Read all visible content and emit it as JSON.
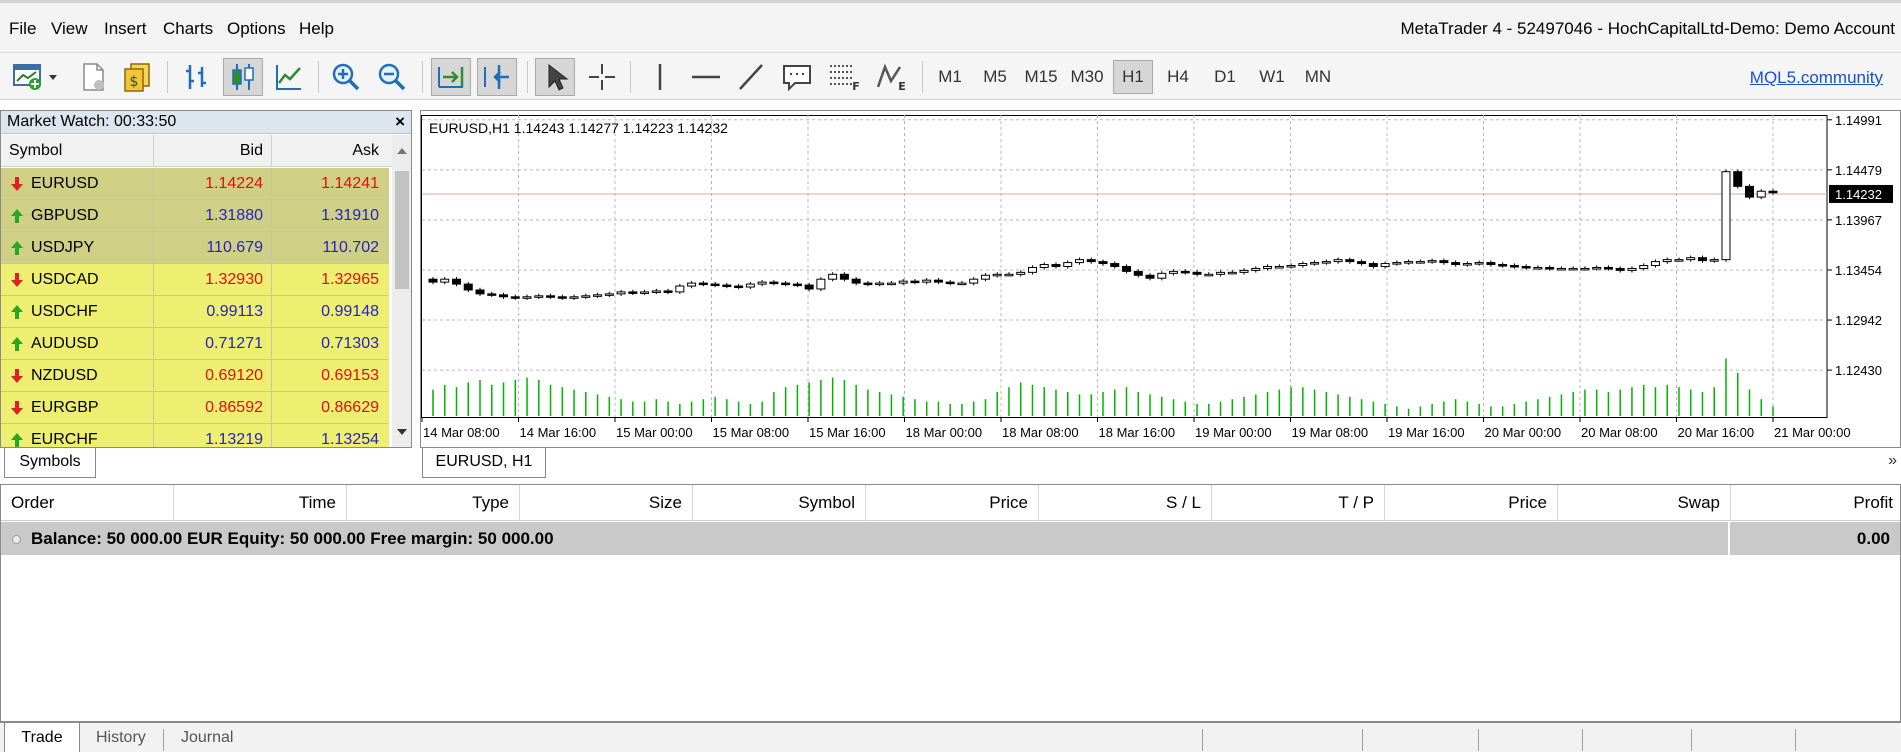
{
  "menu": [
    "File",
    "View",
    "Insert",
    "Charts",
    "Options",
    "Help"
  ],
  "window_title": "MetaTrader 4 - 52497046 - HochCapitalLtd-Demo: Demo Account",
  "toolbar": {
    "timeframes": [
      "M1",
      "M5",
      "M15",
      "M30",
      "H1",
      "H4",
      "D1",
      "W1",
      "MN"
    ],
    "active_timeframe": "H1",
    "community_link": "MQL5.community"
  },
  "market_watch": {
    "title": "Market Watch: 00:33:50",
    "columns": [
      "Symbol",
      "Bid",
      "Ask"
    ],
    "rows": [
      {
        "symbol": "EURUSD",
        "bid": "1.14224",
        "ask": "1.14241",
        "dir": "down",
        "selected": true
      },
      {
        "symbol": "GBPUSD",
        "bid": "1.31880",
        "ask": "1.31910",
        "dir": "up",
        "selected": true
      },
      {
        "symbol": "USDJPY",
        "bid": "110.679",
        "ask": "110.702",
        "dir": "up",
        "selected": true
      },
      {
        "symbol": "USDCAD",
        "bid": "1.32930",
        "ask": "1.32965",
        "dir": "down",
        "selected": false
      },
      {
        "symbol": "USDCHF",
        "bid": "0.99113",
        "ask": "0.99148",
        "dir": "up",
        "selected": false
      },
      {
        "symbol": "AUDUSD",
        "bid": "0.71271",
        "ask": "0.71303",
        "dir": "up",
        "selected": false
      },
      {
        "symbol": "NZDUSD",
        "bid": "0.69120",
        "ask": "0.69153",
        "dir": "down",
        "selected": false
      },
      {
        "symbol": "EURGBP",
        "bid": "0.86592",
        "ask": "0.86629",
        "dir": "down",
        "selected": false
      },
      {
        "symbol": "EURCHF",
        "bid": "1.13219",
        "ask": "1.13254",
        "dir": "up",
        "selected": false
      }
    ],
    "tab": "Symbols"
  },
  "chart_tab": "EURUSD, H1",
  "chart_data": {
    "type": "candlestick",
    "title": "EURUSD,H1  1.14243 1.14277 1.14223 1.14232",
    "current_price": 1.14232,
    "current_price_label": "1.14232",
    "ylim": [
      1.1195,
      1.1504
    ],
    "y_ticks": [
      1.14991,
      1.14479,
      1.13967,
      1.13454,
      1.12942,
      1.1243
    ],
    "y_tick_labels": [
      "1.14991",
      "1.14479",
      "1.13967",
      "1.13454",
      "1.12942",
      "1.12430"
    ],
    "x_tick_labels": [
      "14 Mar 08:00",
      "14 Mar 16:00",
      "15 Mar 00:00",
      "15 Mar 08:00",
      "15 Mar 16:00",
      "18 Mar 00:00",
      "18 Mar 08:00",
      "18 Mar 16:00",
      "19 Mar 00:00",
      "19 Mar 08:00",
      "19 Mar 16:00",
      "20 Mar 00:00",
      "20 Mar 08:00",
      "20 Mar 16:00",
      "21 Mar 00:00"
    ],
    "grid": true,
    "up_color": "#000000",
    "down_color": "#000000",
    "volume_color": "#00b400",
    "price_line_color": "#d8a8a0",
    "closes": [
      1.1333,
      1.1336,
      1.1331,
      1.1325,
      1.1321,
      1.132,
      1.1318,
      1.1317,
      1.1318,
      1.1319,
      1.1318,
      1.1317,
      1.1318,
      1.1319,
      1.132,
      1.1321,
      1.1323,
      1.1322,
      1.1323,
      1.1324,
      1.1323,
      1.1329,
      1.1332,
      1.1331,
      1.133,
      1.1329,
      1.1328,
      1.1331,
      1.1333,
      1.1332,
      1.1331,
      1.133,
      1.1326,
      1.1336,
      1.1341,
      1.1336,
      1.1332,
      1.1331,
      1.1332,
      1.1332,
      1.1334,
      1.1333,
      1.1335,
      1.1333,
      1.1332,
      1.1332,
      1.1336,
      1.134,
      1.1341,
      1.1341,
      1.1343,
      1.1348,
      1.1351,
      1.1349,
      1.1353,
      1.1356,
      1.1354,
      1.1352,
      1.1349,
      1.1344,
      1.134,
      1.1337,
      1.1342,
      1.1344,
      1.1343,
      1.1341,
      1.1341,
      1.1343,
      1.1343,
      1.1345,
      1.1347,
      1.1349,
      1.1349,
      1.135,
      1.1352,
      1.1353,
      1.1354,
      1.1356,
      1.1354,
      1.1352,
      1.1349,
      1.1352,
      1.1353,
      1.1354,
      1.1354,
      1.1355,
      1.1353,
      1.1351,
      1.1352,
      1.1353,
      1.1351,
      1.135,
      1.1349,
      1.1348,
      1.1348,
      1.1347,
      1.1347,
      1.1347,
      1.1347,
      1.1348,
      1.1347,
      1.1345,
      1.1347,
      1.135,
      1.1354,
      1.1356,
      1.1356,
      1.1358,
      1.1355,
      1.1356,
      1.1446,
      1.1431,
      1.142,
      1.1426,
      1.1425
    ],
    "volumes": [
      22,
      26,
      24,
      28,
      30,
      26,
      28,
      30,
      32,
      30,
      26,
      24,
      22,
      20,
      18,
      16,
      14,
      12,
      12,
      14,
      12,
      10,
      12,
      14,
      16,
      14,
      12,
      10,
      12,
      20,
      24,
      26,
      28,
      30,
      32,
      30,
      26,
      22,
      20,
      18,
      16,
      14,
      12,
      12,
      10,
      10,
      12,
      14,
      20,
      24,
      28,
      26,
      24,
      22,
      20,
      18,
      18,
      20,
      22,
      24,
      20,
      18,
      16,
      14,
      12,
      10,
      10,
      12,
      14,
      16,
      18,
      20,
      22,
      24,
      24,
      22,
      20,
      18,
      16,
      14,
      12,
      10,
      8,
      6,
      8,
      10,
      12,
      14,
      12,
      10,
      8,
      8,
      10,
      12,
      14,
      16,
      18,
      20,
      22,
      22,
      20,
      22,
      24,
      26,
      24,
      26,
      24,
      22,
      20,
      24,
      48,
      36,
      22,
      14,
      8
    ]
  },
  "terminal": {
    "columns": [
      "Order",
      "Time",
      "Type",
      "Size",
      "Symbol",
      "Price",
      "S / L",
      "T / P",
      "Price",
      "Swap",
      "Profit"
    ],
    "balance_text": "Balance: 50 000.00 EUR  Equity: 50 000.00  Free margin: 50 000.00",
    "profit": "0.00"
  },
  "bottom_tabs": [
    "Trade",
    "History",
    "Journal"
  ],
  "colors": {
    "bid_up": "#2222cc",
    "bid_down": "#e01010",
    "row_selected": "#cfcf86",
    "row_normal": "#eeee70",
    "arrow_up": "#22aa22",
    "arrow_down": "#dd2222",
    "link": "#1a4fd6"
  }
}
